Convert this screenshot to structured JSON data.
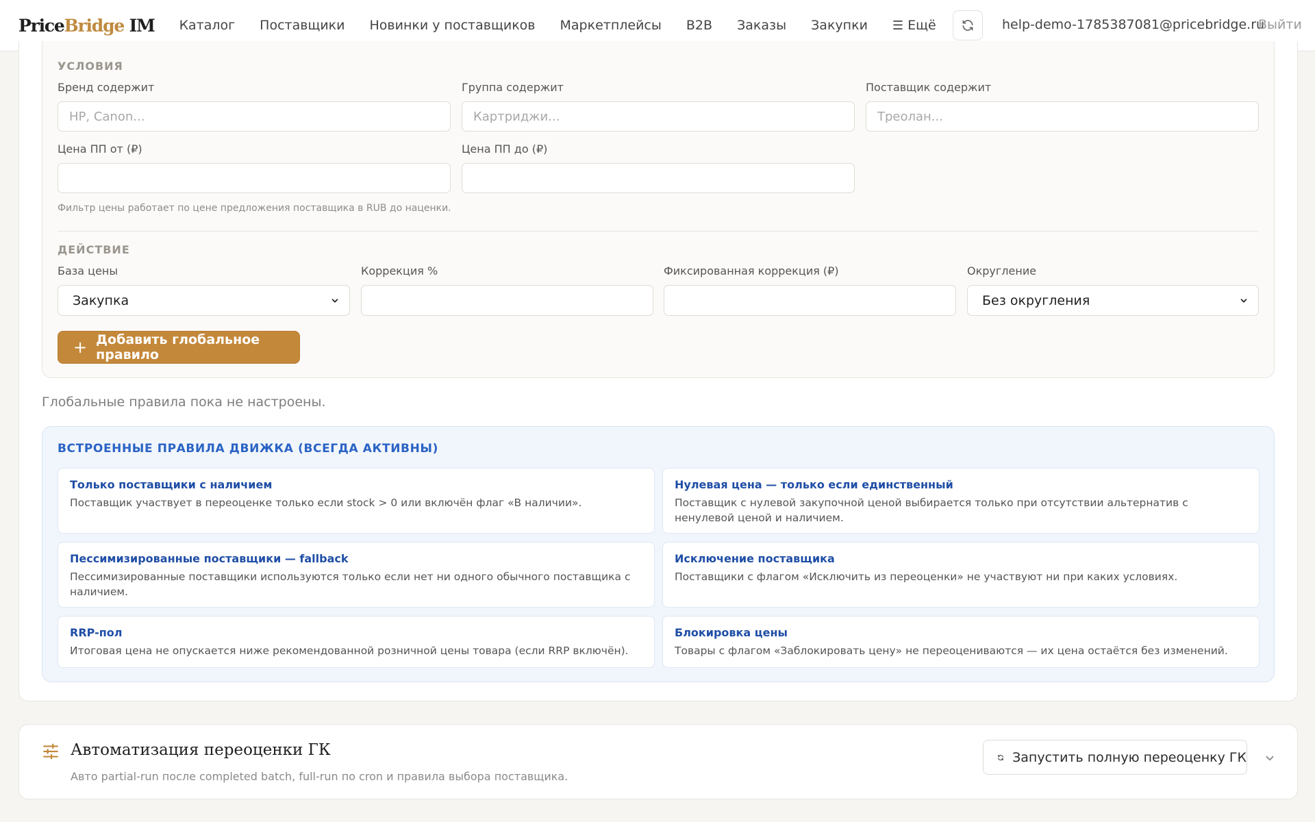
{
  "header": {
    "logo_main": "Price",
    "logo_accent": "Bridge",
    "logo_suffix": " IM",
    "nav": [
      "Каталог",
      "Поставщики",
      "Новинки у поставщиков",
      "Маркетплейсы",
      "B2B",
      "Заказы",
      "Закупки"
    ],
    "more_label": "Ещё",
    "user_email": "help-demo-1785387081@pricebridge.ru",
    "logout_label": "Выйти"
  },
  "conditions": {
    "title": "Условия",
    "brand_label": "Бренд содержит",
    "brand_placeholder": "HP, Canon...",
    "brand_value": "",
    "group_label": "Группа содержит",
    "group_placeholder": "Картриджи...",
    "group_value": "",
    "supplier_label": "Поставщик содержит",
    "supplier_placeholder": "Треолан...",
    "supplier_value": "",
    "price_from_label": "Цена ПП от (₽)",
    "price_from_value": "",
    "price_to_label": "Цена ПП до (₽)",
    "price_to_value": "",
    "hint": "Фильтр цены работает по цене предложения поставщика в RUB до наценки."
  },
  "action": {
    "title": "Действие",
    "base_label": "База цены",
    "base_value": "Закупка",
    "correction_label": "Коррекция %",
    "correction_value": "",
    "fixed_label": "Фиксированная коррекция (₽)",
    "fixed_value": "",
    "rounding_label": "Округление",
    "rounding_value": "Без округления",
    "add_button": "Добавить глобальное правило"
  },
  "empty_note": "Глобальные правила пока не настроены.",
  "builtin": {
    "title": "ВСТРОЕННЫЕ ПРАВИЛА ДВИЖКА (ВСЕГДА АКТИВНЫ)",
    "rules": [
      {
        "title": "Только поставщики с наличием",
        "desc": "Поставщик участвует в переоценке только если stock > 0 или включён флаг «В наличии»."
      },
      {
        "title": "Нулевая цена — только если единственный",
        "desc": "Поставщик с нулевой закупочной ценой выбирается только при отсутствии альтернатив с ненулевой ценой и наличием."
      },
      {
        "title": "Пессимизированные поставщики — fallback",
        "desc": "Пессимизированные поставщики используются только если нет ни одного обычного поставщика с наличием."
      },
      {
        "title": "Исключение поставщика",
        "desc": "Поставщики с флагом «Исключить из переоценки» не участвуют ни при каких условиях."
      },
      {
        "title": "RRP-пол",
        "desc": "Итоговая цена не опускается ниже рекомендованной розничной цены товара (если RRP включён)."
      },
      {
        "title": "Блокировка цены",
        "desc": "Товары с флагом «Заблокировать цену» не переоцениваются — их цена остаётся без изменений."
      }
    ]
  },
  "automation": {
    "title": "Автоматизация переоценки ГК",
    "subtitle": "Авто partial-run после completed batch, full-run по cron и правила выбора поставщика.",
    "run_button": "Запустить полную переоценку ГК"
  },
  "colors": {
    "accent": "#c4883a",
    "rule_title": "#1f4ea6",
    "builtin_bg": "#f1f6fc"
  },
  "icons": [
    "refresh-icon",
    "burger-icon",
    "plus-icon",
    "chevron-down-icon",
    "sliders-icon"
  ]
}
